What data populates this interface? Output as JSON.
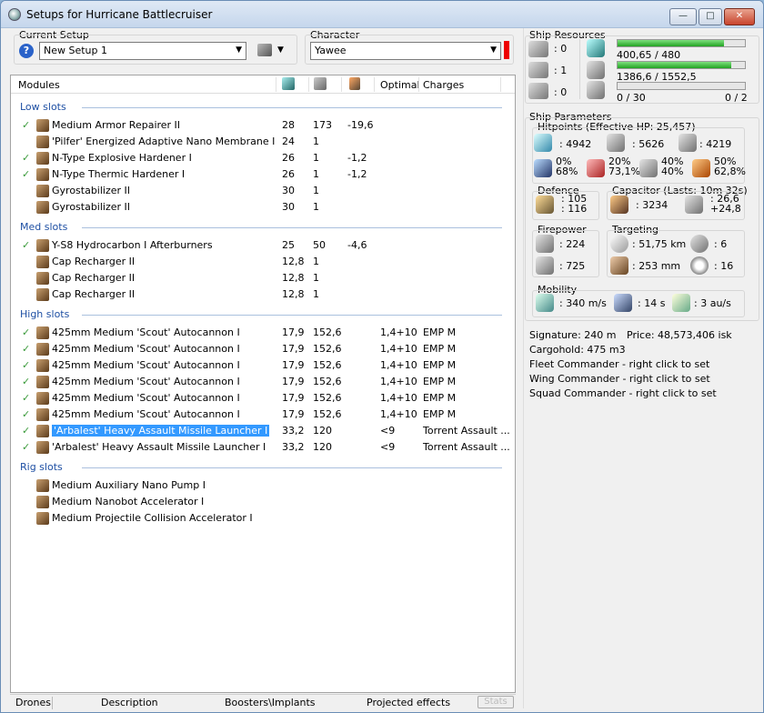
{
  "window": {
    "title": "Setups for Hurricane Battlecruiser",
    "min": "—",
    "max": "□",
    "close": "✕"
  },
  "setup": {
    "label": "Current Setup",
    "value": "New Setup 1",
    "help": "?"
  },
  "character": {
    "label": "Character",
    "value": "Yawee"
  },
  "table": {
    "headers": [
      "Modules",
      "",
      "",
      "",
      "Optimal",
      "Charges"
    ]
  },
  "sections": {
    "low": {
      "title": "Low slots",
      "rows": [
        {
          "check": "✓",
          "name": "Medium Armor Repairer II",
          "c1": "28",
          "c2": "173",
          "c3": "-19,6",
          "opt": "",
          "charge": ""
        },
        {
          "check": "",
          "name": "'Pilfer' Energized Adaptive Nano Membrane I",
          "c1": "24",
          "c2": "1",
          "c3": "",
          "opt": "",
          "charge": ""
        },
        {
          "check": "✓",
          "name": "N-Type Explosive Hardener I",
          "c1": "26",
          "c2": "1",
          "c3": "-1,2",
          "opt": "",
          "charge": ""
        },
        {
          "check": "✓",
          "name": "N-Type Thermic Hardener I",
          "c1": "26",
          "c2": "1",
          "c3": "-1,2",
          "opt": "",
          "charge": ""
        },
        {
          "check": "",
          "name": "Gyrostabilizer II",
          "c1": "30",
          "c2": "1",
          "c3": "",
          "opt": "",
          "charge": ""
        },
        {
          "check": "",
          "name": "Gyrostabilizer II",
          "c1": "30",
          "c2": "1",
          "c3": "",
          "opt": "",
          "charge": ""
        }
      ]
    },
    "med": {
      "title": "Med slots",
      "rows": [
        {
          "check": "✓",
          "name": "Y-S8 Hydrocarbon I Afterburners",
          "c1": "25",
          "c2": "50",
          "c3": "-4,6",
          "opt": "",
          "charge": ""
        },
        {
          "check": "",
          "name": "Cap Recharger II",
          "c1": "12,8",
          "c2": "1",
          "c3": "",
          "opt": "",
          "charge": ""
        },
        {
          "check": "",
          "name": "Cap Recharger II",
          "c1": "12,8",
          "c2": "1",
          "c3": "",
          "opt": "",
          "charge": ""
        },
        {
          "check": "",
          "name": "Cap Recharger II",
          "c1": "12,8",
          "c2": "1",
          "c3": "",
          "opt": "",
          "charge": ""
        }
      ]
    },
    "high": {
      "title": "High slots",
      "rows": [
        {
          "check": "✓",
          "name": "425mm Medium 'Scout' Autocannon I",
          "c1": "17,9",
          "c2": "152,6",
          "c3": "",
          "opt": "1,4+10",
          "charge": "EMP M"
        },
        {
          "check": "✓",
          "name": "425mm Medium 'Scout' Autocannon I",
          "c1": "17,9",
          "c2": "152,6",
          "c3": "",
          "opt": "1,4+10",
          "charge": "EMP M"
        },
        {
          "check": "✓",
          "name": "425mm Medium 'Scout' Autocannon I",
          "c1": "17,9",
          "c2": "152,6",
          "c3": "",
          "opt": "1,4+10",
          "charge": "EMP M"
        },
        {
          "check": "✓",
          "name": "425mm Medium 'Scout' Autocannon I",
          "c1": "17,9",
          "c2": "152,6",
          "c3": "",
          "opt": "1,4+10",
          "charge": "EMP M"
        },
        {
          "check": "✓",
          "name": "425mm Medium 'Scout' Autocannon I",
          "c1": "17,9",
          "c2": "152,6",
          "c3": "",
          "opt": "1,4+10",
          "charge": "EMP M"
        },
        {
          "check": "✓",
          "name": "425mm Medium 'Scout' Autocannon I",
          "c1": "17,9",
          "c2": "152,6",
          "c3": "",
          "opt": "1,4+10",
          "charge": "EMP M"
        },
        {
          "check": "✓",
          "name": "'Arbalest' Heavy Assault Missile Launcher I",
          "c1": "33,2",
          "c2": "120",
          "c3": "",
          "opt": "<9",
          "charge": "Torrent Assault ..."
        },
        {
          "check": "✓",
          "name": "'Arbalest' Heavy Assault Missile Launcher I",
          "c1": "33,2",
          "c2": "120",
          "c3": "",
          "opt": "<9",
          "charge": "Torrent Assault ..."
        }
      ]
    },
    "rig": {
      "title": "Rig slots",
      "rows": [
        {
          "check": "",
          "name": "Medium Auxiliary Nano Pump I",
          "c1": "",
          "c2": "",
          "c3": "",
          "opt": "",
          "charge": ""
        },
        {
          "check": "",
          "name": "Medium Nanobot Accelerator I",
          "c1": "",
          "c2": "",
          "c3": "",
          "opt": "",
          "charge": ""
        },
        {
          "check": "",
          "name": "Medium Projectile Collision Accelerator I",
          "c1": "",
          "c2": "",
          "c3": "",
          "opt": "",
          "charge": ""
        }
      ]
    }
  },
  "resources": {
    "title": "Ship Resources",
    "turrets": ": 0",
    "launchers": ": 1",
    "drones": ": 0",
    "cpu": {
      "text": "400,65 / 480",
      "fraction": 0.835
    },
    "pg": {
      "text": "1386,6 / 1552,5",
      "fraction": 0.893
    },
    "calib": {
      "text": "0 / 30",
      "fraction": 0,
      "right": "0 / 2"
    }
  },
  "params": {
    "title": "Ship Parameters",
    "hitpoints": "Hitpoints (Effective HP: 25,457)",
    "shield": ": 4942",
    "armor": ": 5626",
    "hull": ": 4219",
    "res": [
      {
        "a": "0%",
        "b": "68%"
      },
      {
        "a": "20%",
        "b": "73,1%"
      },
      {
        "a": "40%",
        "b": "40%"
      },
      {
        "a": "50%",
        "b": "62,8%"
      }
    ],
    "defence": {
      "title": "Defence",
      "a": ": 105",
      "b": ": 116"
    },
    "capacitor": {
      "title": "Capacitor (Lasts: 10m 32s)",
      "cap": ": 3234",
      "rate_a": ": 26,6",
      "rate_b": "+24,8"
    },
    "firepower": {
      "title": "Firepower",
      "a": ": 224",
      "b": ": 725"
    },
    "targeting": {
      "title": "Targeting",
      "range": ": 51,75 km",
      "targets": ": 6",
      "res": ": 253 mm",
      "sens": ": 16"
    },
    "mobility": {
      "title": "Mobility",
      "speed": ": 340 m/s",
      "align": ": 14 s",
      "warp": ": 3 au/s"
    }
  },
  "info": {
    "signature": "Signature: 240 m",
    "price": "Price: 48,573,406 isk",
    "cargo": "Cargohold: 475 m3",
    "fleet": "Fleet Commander - right click to set",
    "wing": "Wing Commander - right click to set",
    "squad": "Squad Commander - right click to set"
  },
  "bottom": {
    "drones": "Drones",
    "description": "Description",
    "boosters": "Boosters\\Implants",
    "projected": "Projected effects",
    "stats": "Stats"
  }
}
